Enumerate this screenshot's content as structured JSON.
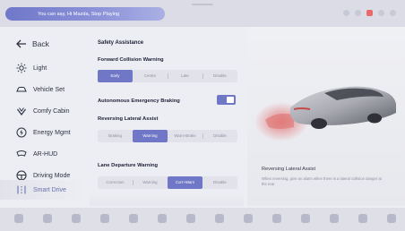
{
  "topbar": {
    "voice_hint": "You can say, Hi Mazda, Stop Playing"
  },
  "sidebar": {
    "back_label": "Back",
    "items": [
      {
        "label": "Light",
        "icon": "light-icon"
      },
      {
        "label": "Vehicle Set",
        "icon": "car-icon"
      },
      {
        "label": "Comfy Cabin",
        "icon": "seat-icon"
      },
      {
        "label": "Energy Mgmt",
        "icon": "energy-icon"
      },
      {
        "label": "AR-HUD",
        "icon": "hud-icon"
      },
      {
        "label": "Driving Mode",
        "icon": "steering-icon"
      },
      {
        "label": "Smart Drive",
        "icon": "smart-drive-icon",
        "active": true
      }
    ]
  },
  "main": {
    "heading": "Safety Assistance",
    "fcw": {
      "title": "Forward Collision Warning",
      "options": [
        "Early",
        "Centre",
        "Late",
        "Disable"
      ],
      "selected": "Early"
    },
    "aeb": {
      "title": "Autonomous Emergency Braking",
      "enabled": true
    },
    "rla": {
      "title": "Reversing Lateral Assist",
      "options": [
        "Braking",
        "Warning",
        "Warn+Brake",
        "Disable"
      ],
      "selected": "Warning"
    },
    "ldw": {
      "title": "Lane Departure Warning",
      "options": [
        "Correction",
        "Warning",
        "Corr+Warn",
        "Disable"
      ],
      "selected": "Corr+Warn"
    }
  },
  "preview": {
    "title": "Reversing Lateral Assist",
    "description": "When reversing, give an alarm when there is a lateral collision danger at the rear",
    "accent_color": "#e05a5a"
  },
  "colors": {
    "accent": "#6f77c6",
    "background": "#eceef3"
  }
}
